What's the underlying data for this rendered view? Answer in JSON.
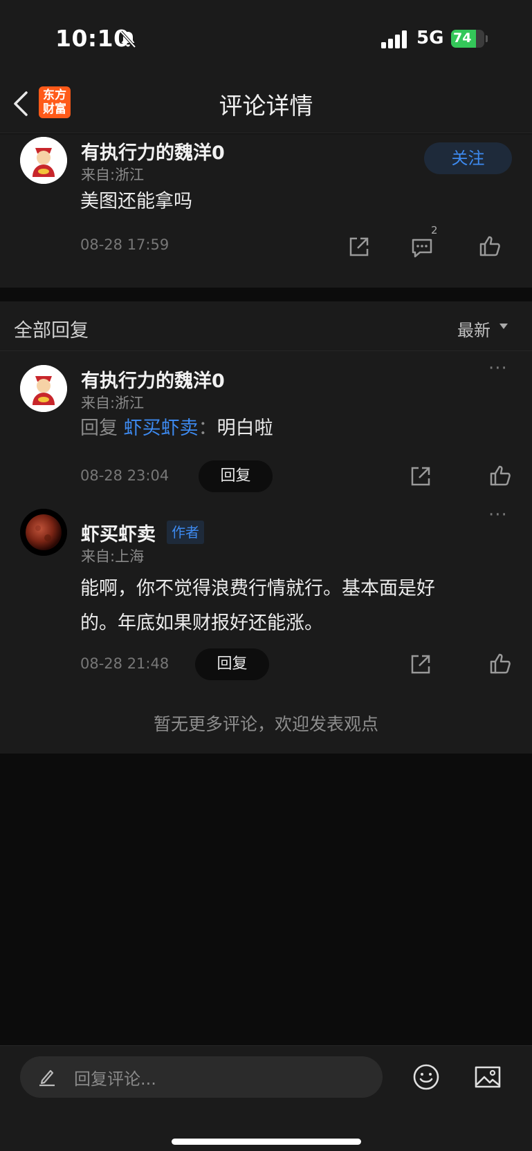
{
  "status_bar": {
    "time": "10:10",
    "network": "5G",
    "battery": "74",
    "battery_level": 0.74
  },
  "nav": {
    "logo_line1": "东方",
    "logo_line2": "财富",
    "title": "评论详情"
  },
  "main_comment": {
    "username": "有执行力的魏洋0",
    "location": "来自:浙江",
    "content": "美图还能拿吗",
    "time": "08-28 17:59",
    "follow_label": "关注",
    "comment_count": "2"
  },
  "replies_header": {
    "title": "全部回复",
    "sort_label": "最新"
  },
  "replies": [
    {
      "username": "有执行力的魏洋0",
      "location": "来自:浙江",
      "reply_prefix": "回复",
      "reply_target": "虾买虾卖",
      "reply_sep": "：",
      "content": "明白啦",
      "time": "08-28 23:04",
      "reply_label": "回复"
    },
    {
      "username": "虾买虾卖",
      "author_tag": "作者",
      "location": "来自:上海",
      "content_line1": "能啊，你不觉得浪费行情就行。基本面是好",
      "content_line2": "的。年底如果财报好还能涨。",
      "time": "08-28 21:48",
      "reply_label": "回复"
    }
  ],
  "no_more_text": "暂无更多评论，欢迎发表观点",
  "bottom_bar": {
    "placeholder": "回复评论..."
  },
  "more_symbol": "···",
  "colors": {
    "accent": "#3d8af0",
    "brand": "#ff5a19",
    "battery": "#34c759"
  }
}
